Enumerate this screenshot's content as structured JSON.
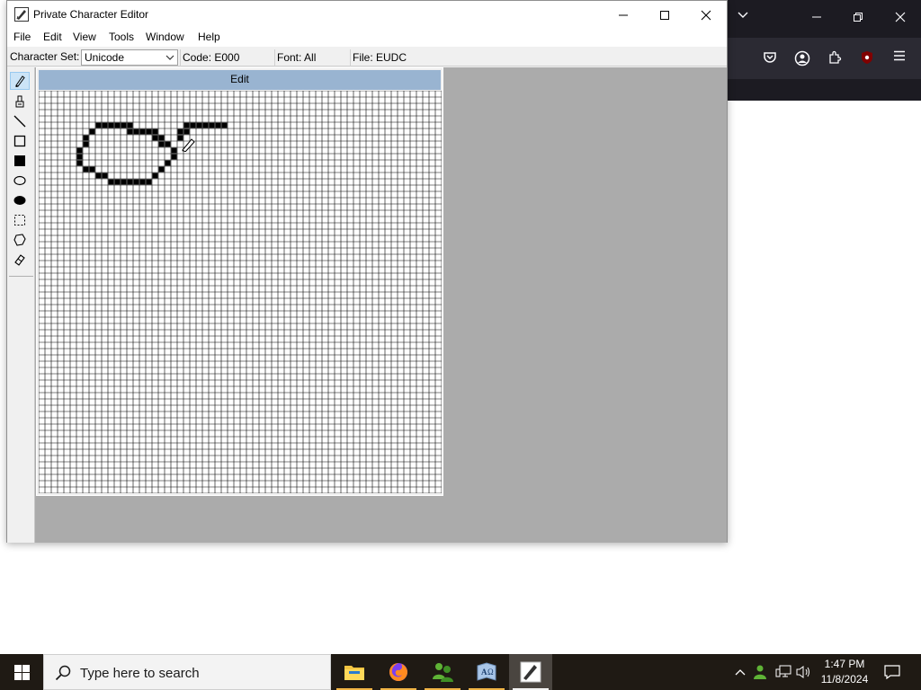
{
  "window": {
    "title": "Private Character Editor"
  },
  "menu": [
    "File",
    "Edit",
    "View",
    "Tools",
    "Window",
    "Help"
  ],
  "info_bar": {
    "charset_label": "Character Set:",
    "charset_value": "Unicode",
    "code": "Code: E000",
    "font": "Font: All",
    "file": "File: EUDC"
  },
  "tools": [
    {
      "name": "pencil",
      "active": true
    },
    {
      "name": "brush",
      "active": false
    },
    {
      "name": "straight-line",
      "active": false
    },
    {
      "name": "hollow-rectangle",
      "active": false
    },
    {
      "name": "filled-rectangle",
      "active": false
    },
    {
      "name": "hollow-ellipse",
      "active": false
    },
    {
      "name": "filled-ellipse",
      "active": false
    },
    {
      "name": "rectangular-selection",
      "active": false
    },
    {
      "name": "freeform-selection",
      "active": false
    },
    {
      "name": "eraser",
      "active": false
    }
  ],
  "edit_window": {
    "title": "Edit",
    "grid_size": 64,
    "filled_cells": [
      [
        9,
        5
      ],
      [
        10,
        5
      ],
      [
        11,
        5
      ],
      [
        12,
        5
      ],
      [
        13,
        5
      ],
      [
        14,
        5
      ],
      [
        8,
        6
      ],
      [
        14,
        6
      ],
      [
        15,
        6
      ],
      [
        16,
        6
      ],
      [
        17,
        6
      ],
      [
        18,
        6
      ],
      [
        7,
        7
      ],
      [
        18,
        7
      ],
      [
        19,
        7
      ],
      [
        7,
        8
      ],
      [
        19,
        8
      ],
      [
        20,
        8
      ],
      [
        6,
        9
      ],
      [
        21,
        9
      ],
      [
        6,
        10
      ],
      [
        21,
        10
      ],
      [
        6,
        11
      ],
      [
        20,
        11
      ],
      [
        7,
        12
      ],
      [
        8,
        12
      ],
      [
        19,
        12
      ],
      [
        9,
        13
      ],
      [
        10,
        13
      ],
      [
        18,
        13
      ],
      [
        11,
        14
      ],
      [
        12,
        14
      ],
      [
        13,
        14
      ],
      [
        14,
        14
      ],
      [
        15,
        14
      ],
      [
        16,
        14
      ],
      [
        17,
        14
      ],
      [
        23,
        5
      ],
      [
        24,
        5
      ],
      [
        25,
        5
      ],
      [
        26,
        5
      ],
      [
        27,
        5
      ],
      [
        28,
        5
      ],
      [
        29,
        5
      ],
      [
        22,
        6
      ],
      [
        23,
        6
      ],
      [
        22,
        7
      ]
    ]
  },
  "taskbar": {
    "search_placeholder": "Type here to search",
    "apps": [
      "file-explorer",
      "firefox",
      "people-app",
      "character-map",
      "private-character-editor"
    ],
    "time": "1:47 PM",
    "date": "11/8/2024"
  },
  "colors": {
    "edit_title_bg": "#99b4d1",
    "mdi_bg": "#ababab",
    "taskbar_bg": "#1f1a14",
    "browser_bg": "#1c1b22"
  }
}
